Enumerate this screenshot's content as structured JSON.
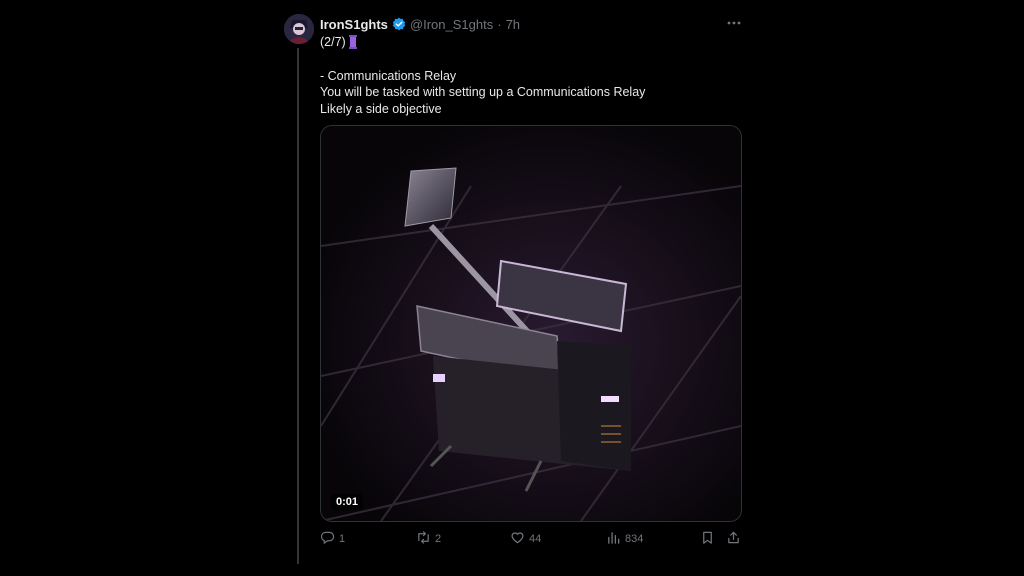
{
  "tweet": {
    "author": {
      "display_name": "IronS1ghts",
      "handle": "@Iron_S1ghts",
      "verified": true
    },
    "time_separator": "·",
    "time": "7h",
    "lines": [
      "(2/7)",
      "- Communications Relay",
      "You will be tasked with setting up a Communications Relay",
      "Likely a side objective"
    ],
    "video": {
      "timestamp": "0:01"
    },
    "metrics": {
      "replies": "1",
      "reposts": "2",
      "likes": "44",
      "views": "834"
    }
  },
  "icons": {
    "verified": "verified-badge-icon",
    "more": "more-icon",
    "reply": "reply-icon",
    "repost": "repost-icon",
    "like": "heart-icon",
    "views": "views-icon",
    "bookmark": "bookmark-icon",
    "share": "share-icon"
  },
  "colors": {
    "background": "#000000",
    "text": "#e7e9ea",
    "muted": "#71767b",
    "verified": "#1d9bf0",
    "border": "#2f3336"
  }
}
